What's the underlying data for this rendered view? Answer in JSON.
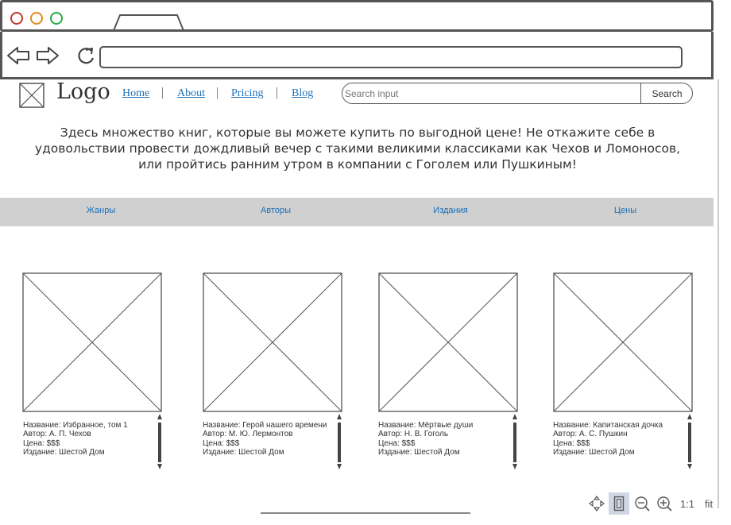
{
  "header": {
    "logo_text": "Logo",
    "nav": [
      "Home",
      "About",
      "Pricing",
      "Blog"
    ],
    "search_placeholder": "Search input",
    "search_button": "Search"
  },
  "intro_text": "Здесь множество книг, которые вы можете купить по выгодной цене! Не откажите себе в удовольствии провести дождливый вечер с такими великими классиками как Чехов и Ломоносов, или пройтись ранним утром в компании с Гоголем или Пушкиным!",
  "categories": [
    "Жанры",
    "Авторы",
    "Издания",
    "Цены"
  ],
  "books": [
    {
      "title": "Название: Избранное, том 1",
      "author": "Автор: А. П. Чехов",
      "price": "Цена: $$$",
      "publisher": "Издание: Шестой Дом"
    },
    {
      "title": "Название: Герой нашего времени",
      "author": "Автор: М. Ю. Лермонтов",
      "price": "Цена: $$$",
      "publisher": "Издание: Шестой Дом"
    },
    {
      "title": "Название: Мёртвые души",
      "author": "Автор: Н. В. Гоголь",
      "price": "Цена: $$$",
      "publisher": "Издание: Шестой Дом"
    },
    {
      "title": "Название: Капитанская дочка",
      "author": "Автор: А. С. Пушкин",
      "price": "Цена: $$$",
      "publisher": "Издание: Шестой Дом"
    }
  ],
  "toolbar": {
    "items": [
      "move-icon",
      "fit-page-icon",
      "zoom-out-icon",
      "zoom-in-icon"
    ],
    "one_to_one": "1:1",
    "fit": "fit"
  },
  "colors": {
    "link": "#1a70b8",
    "category_bar": "#d0d0d0"
  }
}
